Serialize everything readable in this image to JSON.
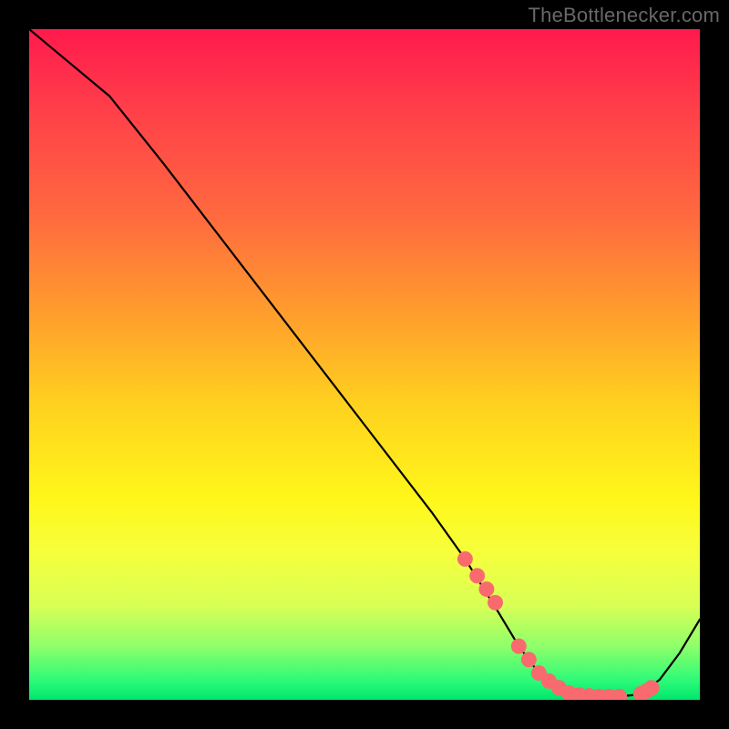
{
  "attribution": "TheBottlenecker.com",
  "chart_data": {
    "type": "line",
    "title": "",
    "xlabel": "",
    "ylabel": "",
    "xlim": [
      0,
      100
    ],
    "ylim": [
      0,
      100
    ],
    "series": [
      {
        "name": "bottleneck-curve",
        "x": [
          0,
          6,
          12,
          20,
          30,
          40,
          50,
          60,
          65,
          70,
          73,
          76,
          80,
          84,
          88,
          91,
          94,
          97,
          100
        ],
        "y": [
          100,
          95,
          90,
          80,
          67,
          54,
          41,
          28,
          21,
          13,
          8,
          4,
          1,
          0.5,
          0.5,
          0.8,
          3,
          7,
          12
        ]
      }
    ],
    "highlight_points": {
      "name": "selected-range",
      "x": [
        65.0,
        66.8,
        68.2,
        69.5,
        73.0,
        74.5,
        76.0,
        77.5,
        79.0,
        80.5,
        82.0,
        83.5,
        85.0,
        86.5,
        88.0,
        91.2,
        92.0,
        92.8
      ],
      "y": [
        21.0,
        18.5,
        16.5,
        14.5,
        8.0,
        6.0,
        4.0,
        2.8,
        1.8,
        1.0,
        0.7,
        0.6,
        0.5,
        0.5,
        0.5,
        0.9,
        1.3,
        1.8
      ]
    },
    "highlight_color": "#f86a6e",
    "curve_color": "#000000"
  }
}
